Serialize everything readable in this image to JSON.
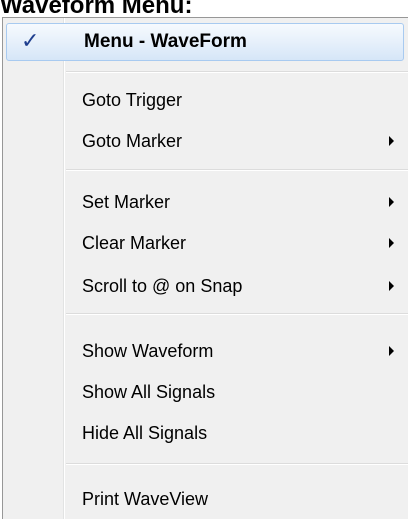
{
  "page": {
    "title": "Waveform Menu:"
  },
  "menu": {
    "header": {
      "check_glyph": "✓",
      "label": "Menu - WaveForm"
    },
    "groups": [
      {
        "items": [
          {
            "label": "Goto Trigger",
            "has_submenu": false
          },
          {
            "label": "Goto Marker",
            "has_submenu": true
          }
        ]
      },
      {
        "items": [
          {
            "label": "Set Marker",
            "has_submenu": true
          },
          {
            "label": "Clear Marker",
            "has_submenu": true
          },
          {
            "label": "Scroll to @ on Snap",
            "has_submenu": true
          }
        ]
      },
      {
        "items": [
          {
            "label": "Show Waveform",
            "has_submenu": true
          },
          {
            "label": "Show All Signals",
            "has_submenu": false
          },
          {
            "label": "Hide All Signals",
            "has_submenu": false
          }
        ]
      },
      {
        "items": [
          {
            "label": "Print WaveView",
            "has_submenu": false
          }
        ]
      }
    ]
  },
  "icons": {
    "header_check": "check-icon",
    "submenu_arrow": "submenu-arrow-icon"
  },
  "colors": {
    "menu_background": "#f0f0f0",
    "header_highlight": "#e8f1fb",
    "header_border": "#a8caf0",
    "check": "#1f3f8f"
  }
}
